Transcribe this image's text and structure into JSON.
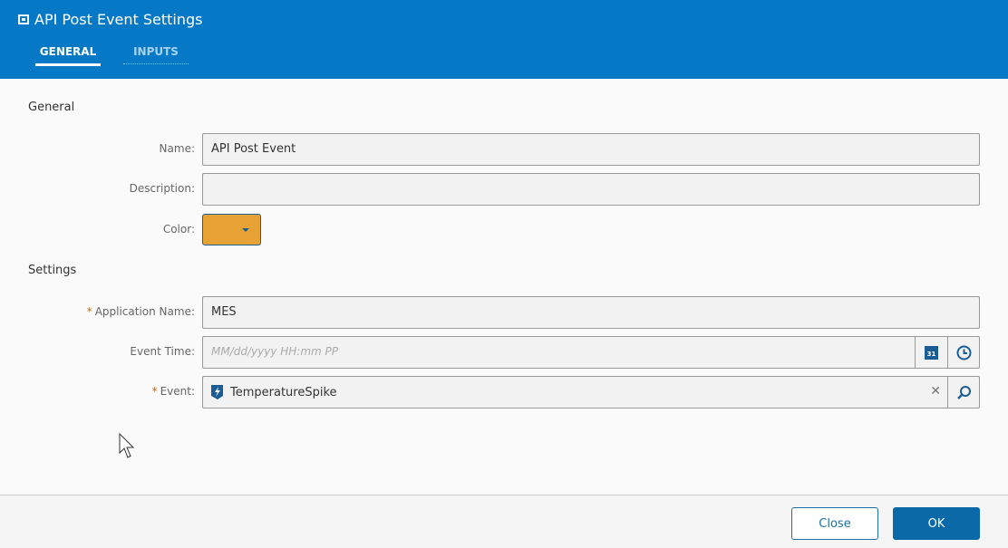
{
  "header": {
    "title": "API Post Event Settings",
    "tabs": [
      {
        "label": "GENERAL"
      },
      {
        "label": "INPUTS"
      }
    ]
  },
  "general": {
    "heading": "General",
    "name_label": "Name:",
    "name_value": "API Post Event",
    "description_label": "Description:",
    "description_value": "",
    "color_label": "Color:",
    "color_value": "#e6a235"
  },
  "settings": {
    "heading": "Settings",
    "app_label": "Application Name:",
    "app_value": "MES",
    "time_label": "Event Time:",
    "time_placeholder": "MM/dd/yyyy HH:mm PP",
    "event_label": "Event:",
    "event_value": "TemperatureSpike",
    "required_mark": "*",
    "calendar_day": "31"
  },
  "footer": {
    "close_label": "Close",
    "ok_label": "OK"
  }
}
